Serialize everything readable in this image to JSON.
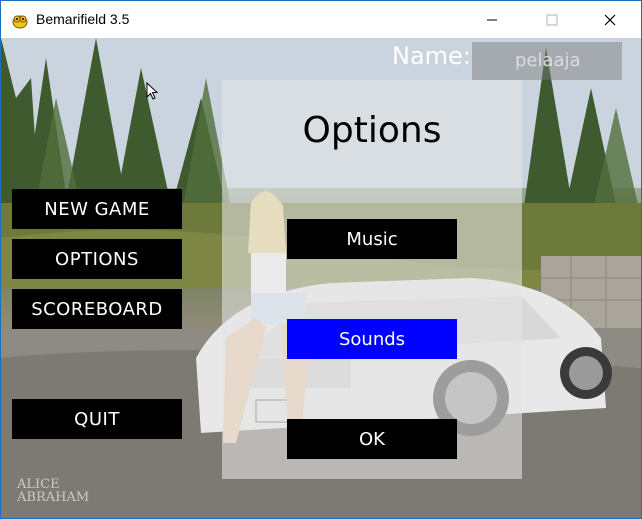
{
  "window": {
    "title": "Bemarifield 3.5",
    "app_icon": "pygame-snake-icon",
    "controls": [
      "minimize-icon",
      "maximize-icon",
      "close-icon"
    ]
  },
  "header": {
    "name_label": "Name:",
    "name_value": "pelaaja"
  },
  "main_menu": {
    "new_game": "NEW GAME",
    "options": "OPTIONS",
    "scoreboard": "SCOREBOARD",
    "quit": "QUIT"
  },
  "options_panel": {
    "title": "Options",
    "music": "Music",
    "sounds": "Sounds",
    "ok": "OK",
    "selected": "Sounds"
  },
  "background": {
    "watermark_line1": "ALICE",
    "watermark_line2": "ABRAHAM"
  },
  "colors": {
    "button_bg": "#000000",
    "button_text": "#ffffff",
    "selected_bg": "#0000ff",
    "panel_bg": "#e6e6e6"
  }
}
